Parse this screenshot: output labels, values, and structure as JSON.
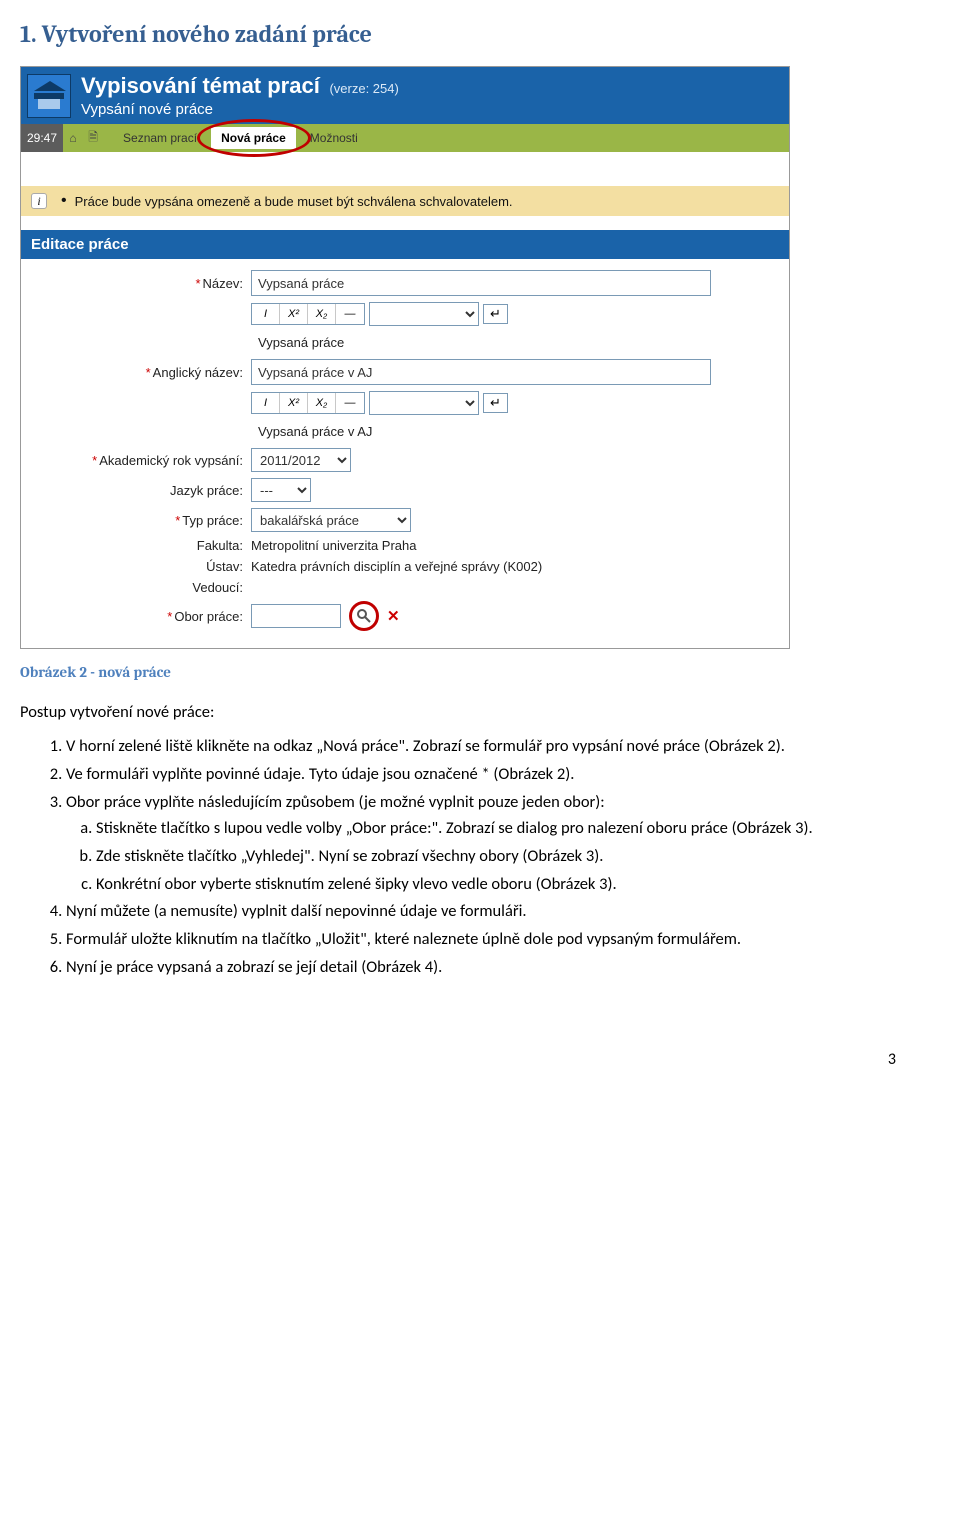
{
  "heading": "1. Vytvoření nového zadání práce",
  "app": {
    "title": "Vypisování témat prací",
    "version": "(verze: 254)",
    "subtitle": "Vypsání nové práce",
    "time": "29:47",
    "tabs": {
      "list": "Seznam prací",
      "new": "Nová práce",
      "options": "Možnosti"
    },
    "info_text": "Práce bude vypsána omezeně a bude muset být schválena schvalovatelem.",
    "section_title": "Editace práce",
    "form": {
      "name_label": "Název:",
      "name_value": "Vypsaná práce",
      "name_readonly": "Vypsaná práce",
      "name_en_label": "Anglický název:",
      "name_en_value": "Vypsaná práce v AJ",
      "name_en_readonly": "Vypsaná práce v AJ",
      "year_label": "Akademický rok vypsání:",
      "year_value": "2011/2012",
      "lang_label": "Jazyk práce:",
      "lang_value": "---",
      "type_label": "Typ práce:",
      "type_value": "bakalářská práce",
      "faculty_label": "Fakulta:",
      "faculty_value": "Metropolitní univerzita Praha",
      "dept_label": "Ústav:",
      "dept_value": "Katedra právních disciplín a veřejné správy (K002)",
      "supervisor_label": "Vedoucí:",
      "field_label": "Obor práce:"
    },
    "fmt": {
      "i": "I",
      "x2": "X²",
      "x2b": "X₂",
      "dash": "—"
    }
  },
  "caption": "Obrázek 2 - nová práce",
  "lead": "Postup vytvoření nové práce:",
  "steps": {
    "s1": "V horní zelené liště klikněte na odkaz „Nová práce\". Zobrazí se formulář pro vypsání nové práce (Obrázek 2).",
    "s2": "Ve formuláři vyplňte povinné údaje. Tyto údaje jsou označené * (Obrázek 2).",
    "s3": "Obor práce vyplňte následujícím způsobem (je možné vyplnit pouze jeden obor):",
    "s3a": "Stiskněte tlačítko s lupou vedle volby „Obor práce:\". Zobrazí se dialog pro nalezení oboru práce (Obrázek 3).",
    "s3b": "Zde stiskněte tlačítko „Vyhledej\". Nyní se zobrazí všechny obory (Obrázek 3).",
    "s3c": "Konkrétní obor vyberte stisknutím zelené šipky vlevo vedle oboru (Obrázek 3).",
    "s4": "Nyní můžete (a nemusíte) vyplnit další nepovinné údaje ve formuláři.",
    "s5": "Formulář uložte kliknutím na tlačítko „Uložit\", které naleznete úplně dole pod vypsaným formulářem.",
    "s6": "Nyní je práce vypsaná a zobrazí se její detail (Obrázek 4)."
  },
  "page_number": "3"
}
